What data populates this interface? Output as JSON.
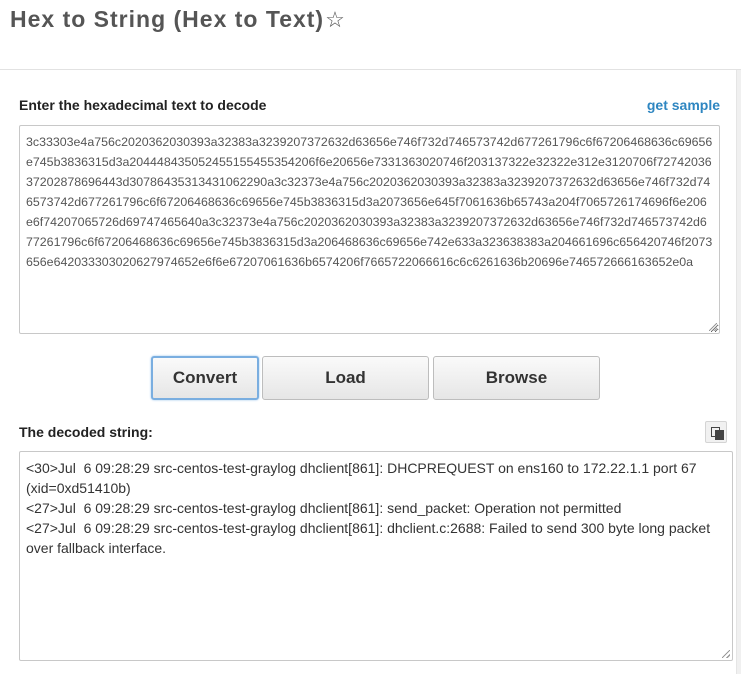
{
  "header": {
    "title": "Hex to String (Hex to Text)",
    "star_glyph": "☆"
  },
  "input": {
    "label": "Enter the hexadecimal text to decode",
    "sample_link": "get sample",
    "value": "3c33303e4a756c2020362030393a32383a3239207372632d63656e746f732d746573742d677261796c6f67206468636c69656e745b3836315d3a204448435052455155455354206f6e20656e7331363020746f203137322e32322e312e3120706f7274203637202878696443d30786435313431062290a3c32373e4a756c2020362030393a32383a3239207372632d63656e746f732d746573742d677261796c6f67206468636c69656e745b3836315d3a2073656e645f7061636b65743a204f7065726174696f6e206e6f74207065726d69747465640a3c32373e4a756c2020362030393a32383a3239207372632d63656e746f732d746573742d677261796c6f67206468636c69656e745b3836315d3a206468636c69656e742e633a323638383a204661696c656420746f2073656e642033303020627974652e6f6e67207061636b6574206f7665722066616c6c6261636b20696e746572666163652e0a"
  },
  "buttons": {
    "convert": "Convert",
    "load": "Load",
    "browse": "Browse"
  },
  "output": {
    "label": "The decoded string:",
    "lines": [
      "<30>Jul  6 09:28:29 src-centos-test-graylog dhclient[861]: DHCPREQUEST on ens160 to 172.22.1.1 port 67 (xid=0xd51410b)",
      "<27>Jul  6 09:28:29 src-centos-test-graylog dhclient[861]: send_packet: Operation not permitted",
      "<27>Jul  6 09:28:29 src-centos-test-graylog dhclient[861]: dhclient.c:2688: Failed to send 300 byte long packet over fallback interface."
    ]
  },
  "colors": {
    "link": "#2e86c1",
    "focus_border": "#7aaee0"
  },
  "icons": {
    "favorite": "star-icon",
    "copy": "copy-icon"
  }
}
